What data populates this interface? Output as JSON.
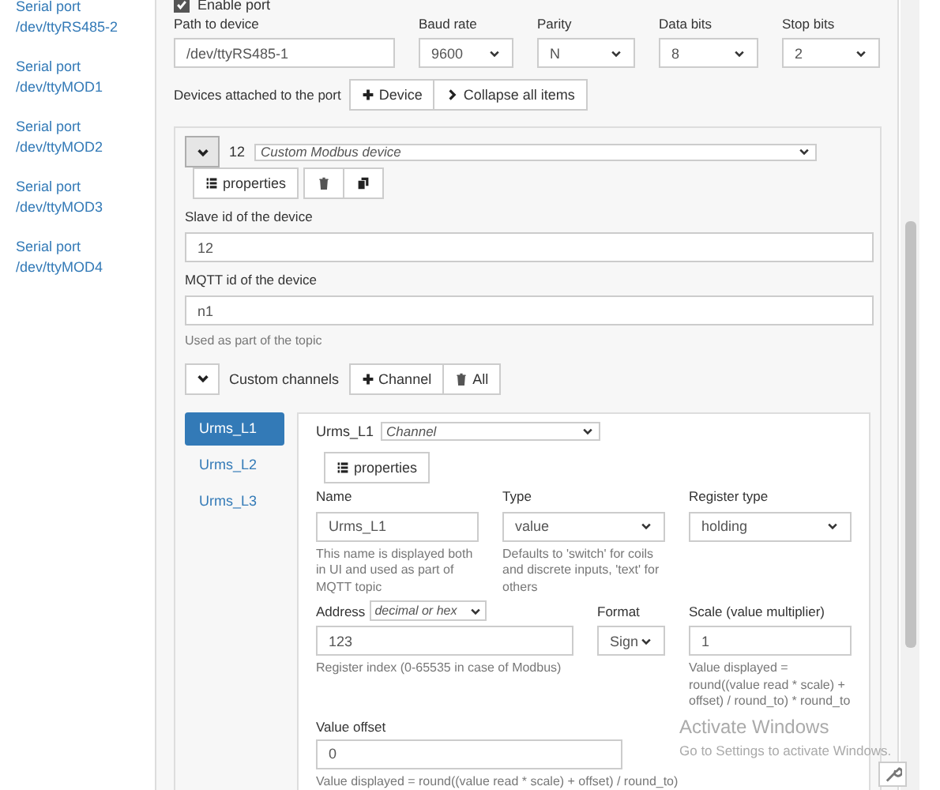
{
  "sidebar": {
    "items": [
      {
        "title": "Serial port",
        "path": "/dev/ttyRS485-2"
      },
      {
        "title": "Serial port",
        "path": "/dev/ttyMOD1"
      },
      {
        "title": "Serial port",
        "path": "/dev/ttyMOD2"
      },
      {
        "title": "Serial port",
        "path": "/dev/ttyMOD3"
      },
      {
        "title": "Serial port",
        "path": "/dev/ttyMOD4"
      }
    ]
  },
  "port": {
    "enable": {
      "label": "Enable port",
      "checked": true
    },
    "fields": [
      {
        "kind": "text",
        "label": "Path to device",
        "value": "/dev/ttyRS485-1"
      },
      {
        "kind": "select",
        "label": "Baud rate",
        "value": "9600"
      },
      {
        "kind": "select",
        "label": "Parity",
        "value": "N"
      },
      {
        "kind": "select",
        "label": "Data bits",
        "value": "8"
      },
      {
        "kind": "select",
        "label": "Stop bits",
        "value": "2"
      }
    ],
    "devices_label": "Devices attached to the port",
    "buttons": [
      {
        "label": "Device"
      },
      {
        "label": "Collapse all items"
      }
    ]
  },
  "device": {
    "expanded": true,
    "number": "12",
    "type": "Custom Modbus device",
    "properties": "properties",
    "fields": [
      {
        "label": "Slave id of the device",
        "value": "12"
      },
      {
        "label": "MQTT id of the device",
        "value": "n1",
        "help": "Used as part of the topic"
      }
    ],
    "channels_expanded": true,
    "channels_label": "Custom channels",
    "channel_buttons": [
      {
        "label": "Channel"
      },
      {
        "label": "All"
      }
    ],
    "channels": [
      {
        "name": "Urms_L1",
        "selected": true
      },
      {
        "name": "Urms_L2",
        "selected": false
      },
      {
        "name": "Urms_L3",
        "selected": false
      }
    ],
    "channel": {
      "name": "Urms_L1",
      "type": "Channel",
      "properties": "properties",
      "row1": [
        {
          "kind": "text",
          "label": "Name",
          "value": "Urms_L1",
          "help": "This name is displayed both in UI and used as part of MQTT topic"
        },
        {
          "kind": "select",
          "label": "Type",
          "value": "value",
          "help": "Defaults to 'switch' for coils and discrete inputs, 'text' for others"
        },
        {
          "kind": "select",
          "label": "Register type",
          "value": "holding"
        }
      ],
      "row2": [
        {
          "kind": "text",
          "label": "Address",
          "mode": "decimal or hex",
          "value": "123",
          "help": "Register index (0-65535 in case of Modbus)"
        },
        {
          "kind": "select",
          "label": "Format",
          "value": "Sign"
        },
        {
          "kind": "text",
          "label": "Scale (value multiplier)",
          "value": "1",
          "help": "Value displayed = round((value read * scale) + offset) / round_to) * round_to"
        }
      ],
      "offset": {
        "label": "Value offset",
        "value": "0",
        "help": "Value displayed = round((value read * scale) + offset) / round_to)"
      }
    }
  },
  "overlay": {
    "title": "Activate Windows",
    "text": "Go to Settings to activate Windows."
  }
}
